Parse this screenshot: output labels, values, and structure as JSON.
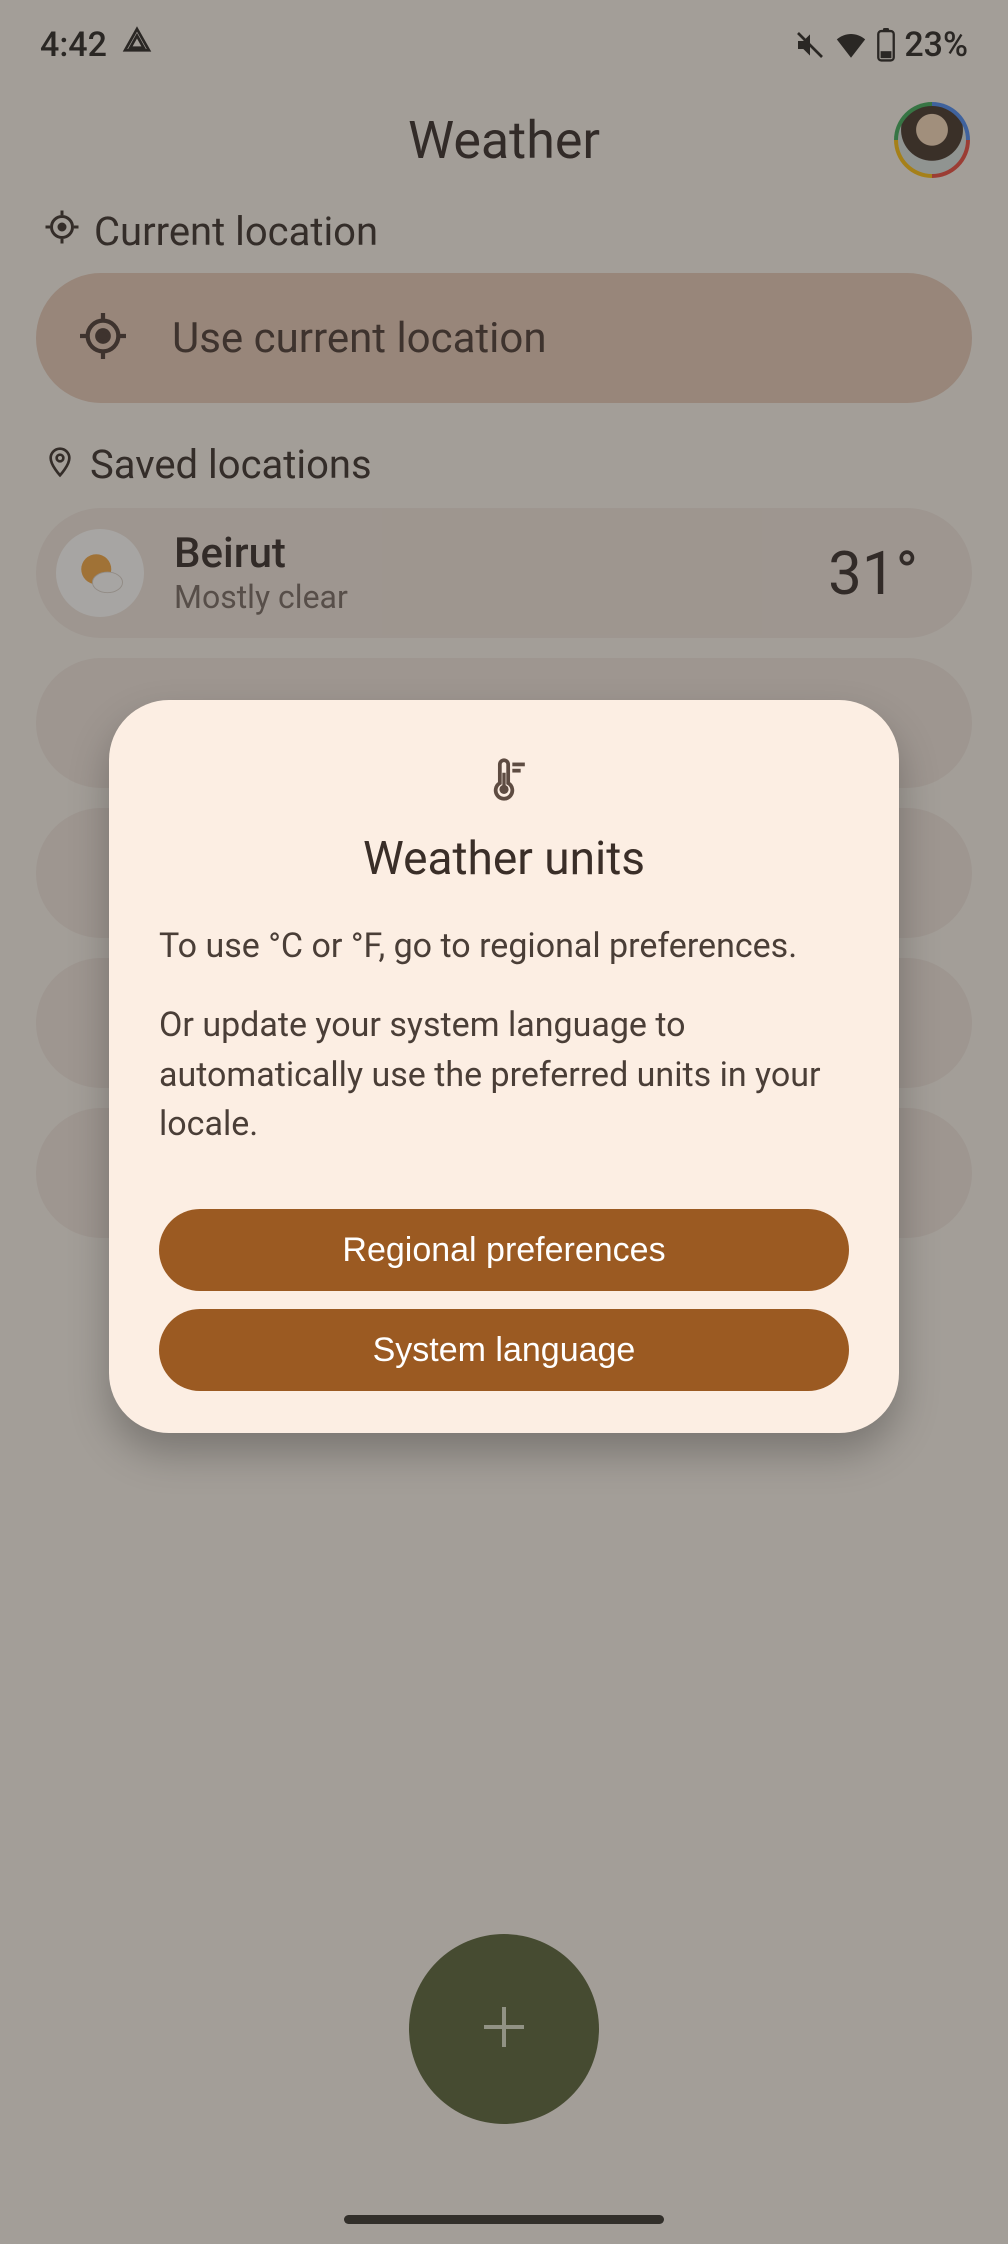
{
  "status": {
    "time": "4:42",
    "battery_text": "23%"
  },
  "header": {
    "title": "Weather"
  },
  "current_location": {
    "section_label": "Current location",
    "use_current_label": "Use current location"
  },
  "saved": {
    "section_label": "Saved locations",
    "items": [
      {
        "name": "Beirut",
        "condition": "Mostly clear",
        "temp": "31°"
      }
    ]
  },
  "dialog": {
    "title": "Weather units",
    "body_1": "To use °C or °F, go to regional preferences.",
    "body_2": "Or update your system language to automatically use the preferred units in your locale.",
    "regional_label": "Regional preferences",
    "language_label": "System language"
  }
}
